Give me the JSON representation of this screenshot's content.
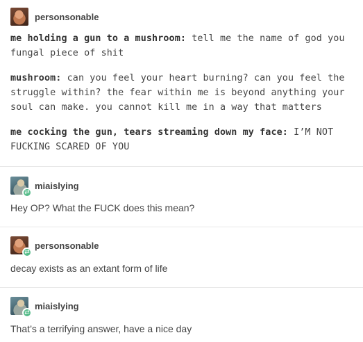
{
  "posts": [
    {
      "username": "personsonable",
      "avatar": "face-avatar",
      "paragraphs": [
        {
          "speaker": "me holding a gun to a mushroom:",
          "text": " tell me the name of god you fungal piece of shit"
        },
        {
          "speaker": "mushroom:",
          "text": " can you feel your heart burning? can you feel the struggle within? the fear within me is beyond anything your soul can make. you cannot kill me in a way that matters"
        },
        {
          "speaker": "me cocking the gun, tears streaming down my face:",
          "text": " I’M NOT FUCKING SCARED OF YOU"
        }
      ]
    },
    {
      "username": "miaislying",
      "avatar": "blue-avatar",
      "text": "Hey OP? What the FUCK does this mean?"
    },
    {
      "username": "personsonable",
      "avatar": "face-avatar",
      "text": "decay exists as an extant form of life"
    },
    {
      "username": "miaislying",
      "avatar": "blue-avatar",
      "text": "That’s a terrifying answer, have a nice day"
    }
  ],
  "badge_icon": "reblog-icon",
  "colors": {
    "badge": "#56bc8a",
    "text": "#444444",
    "divider": "#e7e7e7"
  }
}
